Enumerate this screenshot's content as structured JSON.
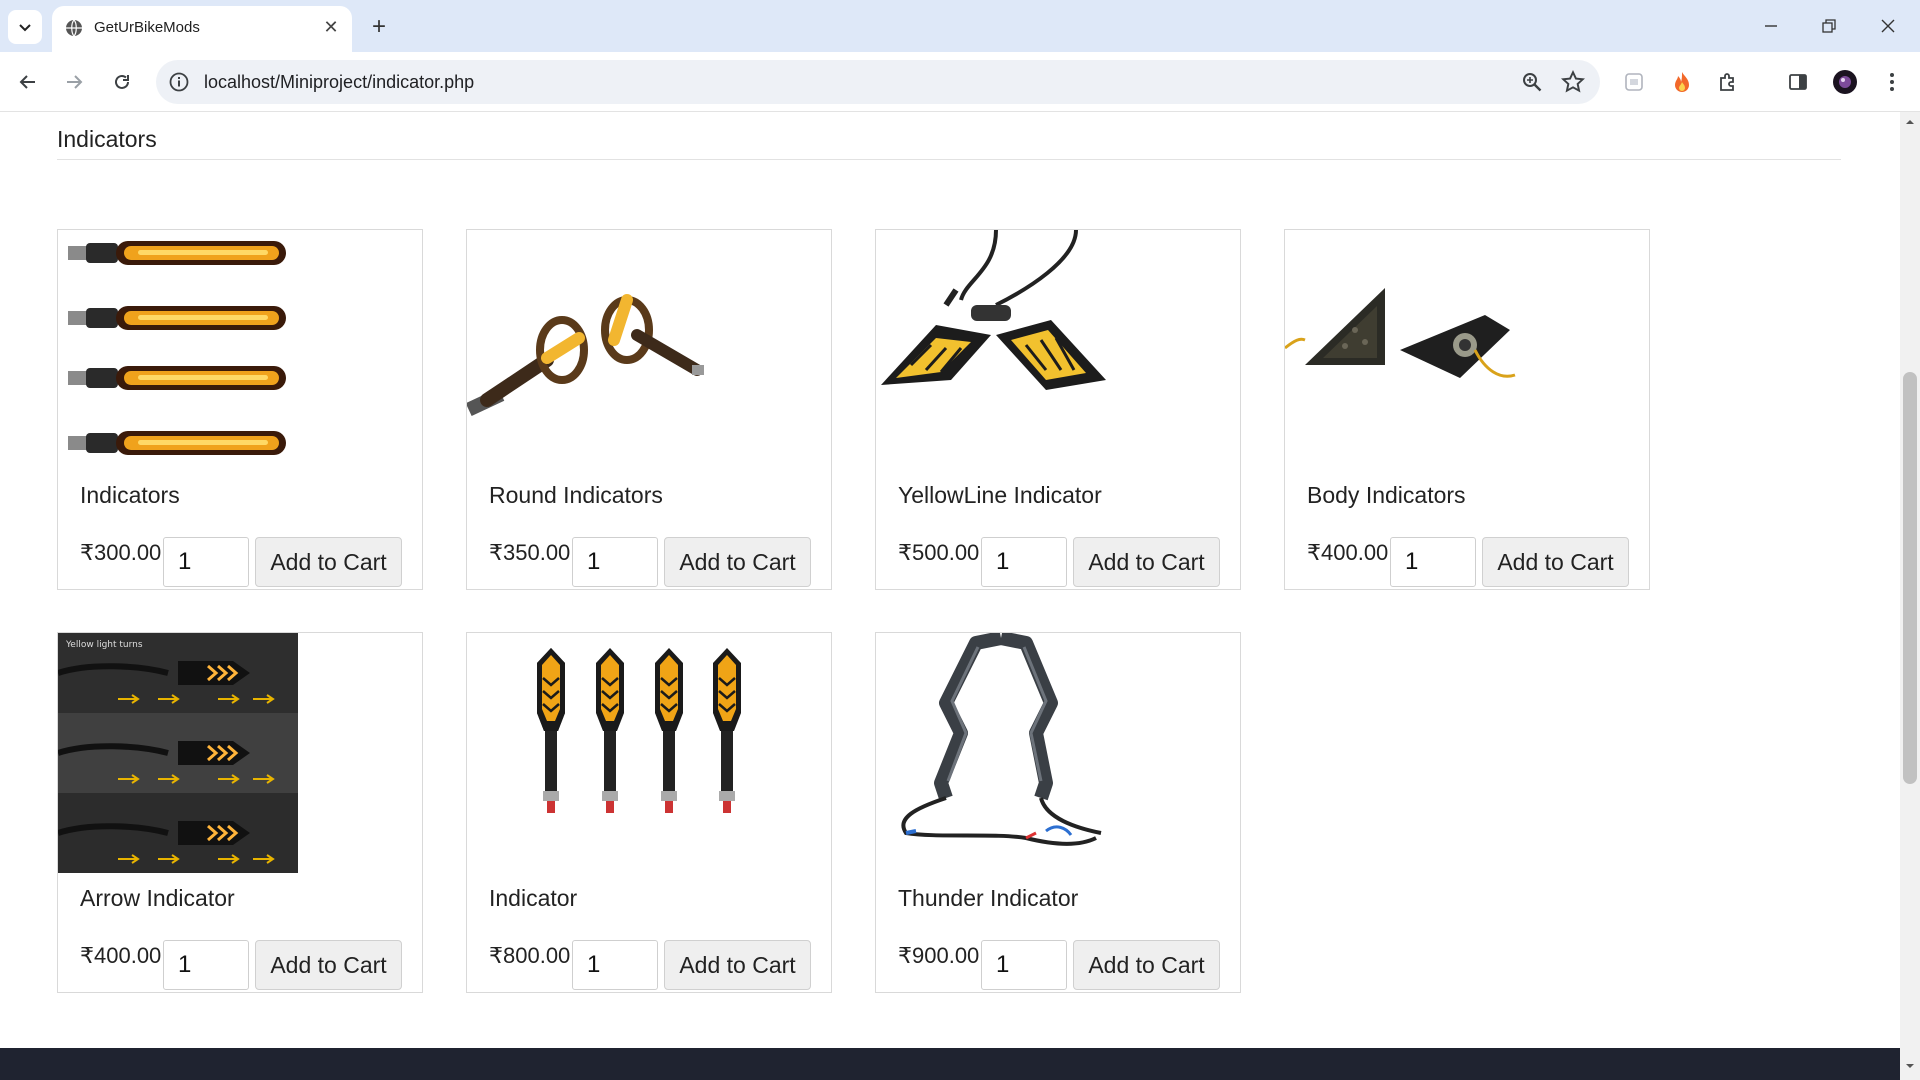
{
  "browser": {
    "tab_title": "GetUrBikeMods",
    "url": "localhost/Miniproject/indicator.php"
  },
  "page": {
    "heading": "Indicators",
    "products": [
      {
        "name": "Indicators",
        "price": "₹300.00",
        "qty": "1",
        "button": "Add to Cart"
      },
      {
        "name": "Round Indicators",
        "price": "₹350.00",
        "qty": "1",
        "button": "Add to Cart"
      },
      {
        "name": "YellowLine Indicator",
        "price": "₹500.00",
        "qty": "1",
        "button": "Add to Cart"
      },
      {
        "name": "Body Indicators",
        "price": "₹400.00",
        "qty": "1",
        "button": "Add to Cart"
      },
      {
        "name": "Arrow Indicator",
        "price": "₹400.00",
        "qty": "1",
        "button": "Add to Cart"
      },
      {
        "name": "Indicator",
        "price": "₹800.00",
        "qty": "1",
        "button": "Add to Cart"
      },
      {
        "name": "Thunder Indicator",
        "price": "₹900.00",
        "qty": "1",
        "button": "Add to Cart"
      }
    ],
    "arrow_image_caption": "Yellow light turns"
  }
}
